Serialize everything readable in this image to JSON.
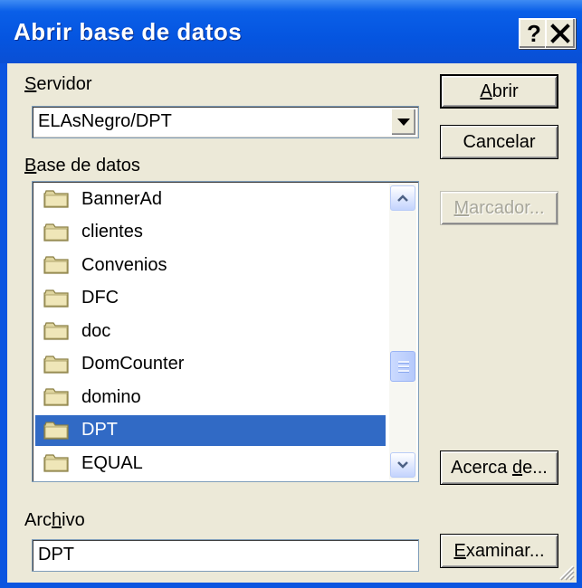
{
  "window": {
    "title": "Abrir base de datos",
    "help_label": "?",
    "close_label": "✕"
  },
  "server": {
    "label_mnemonic": "S",
    "label_rest": "ervidor",
    "value": "ELAsNegro/DPT"
  },
  "database": {
    "label_mnemonic": "B",
    "label_rest": "ase de datos",
    "items": [
      {
        "label": "BannerAd"
      },
      {
        "label": "clientes"
      },
      {
        "label": "Convenios"
      },
      {
        "label": "DFC"
      },
      {
        "label": "doc"
      },
      {
        "label": "DomCounter"
      },
      {
        "label": "domino"
      },
      {
        "label": "DPT"
      },
      {
        "label": "EQUAL"
      }
    ],
    "selected_index": 7
  },
  "file": {
    "label_pre": "Arc",
    "label_mnemonic": "h",
    "label_rest": "ivo",
    "value": "DPT"
  },
  "buttons": {
    "open_mnemonic": "A",
    "open_rest": "brir",
    "cancel": "Cancelar",
    "bookmark_mnemonic": "M",
    "bookmark_rest": "arcador...",
    "about_pre": "Acerca ",
    "about_mnemonic": "d",
    "about_rest": "e...",
    "browse_mnemonic": "E",
    "browse_rest": "xaminar..."
  },
  "colors": {
    "titlebar": "#0555e0",
    "selection": "#316ac5",
    "face": "#ece9d8"
  },
  "icons": {
    "folder": "folder-icon",
    "help": "help-icon",
    "close": "close-icon"
  }
}
